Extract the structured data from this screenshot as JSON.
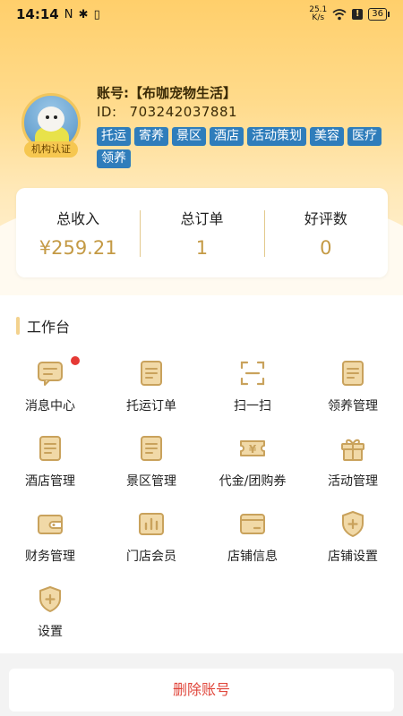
{
  "status_bar": {
    "time": "14:14",
    "left_icons": "N ✱ ▯",
    "speed_top": "25.1",
    "speed_bottom": "K/s",
    "alert": "!",
    "battery": "36"
  },
  "profile": {
    "account_label": "账号:【布咖宠物生活】",
    "id_label": "ID:",
    "id_value": "703242037881",
    "cert_badge": "机构认证",
    "tags": [
      "托运",
      "寄养",
      "景区",
      "酒店",
      "活动策划",
      "美容",
      "医疗",
      "领养"
    ]
  },
  "stats": [
    {
      "label": "总收入",
      "value": "¥259.21"
    },
    {
      "label": "总订单",
      "value": "1"
    },
    {
      "label": "好评数",
      "value": "0"
    }
  ],
  "workbench": {
    "title": "工作台",
    "items": [
      {
        "label": "消息中心",
        "icon": "message-icon",
        "badge": true
      },
      {
        "label": "托运订单",
        "icon": "document-icon"
      },
      {
        "label": "扫一扫",
        "icon": "scan-icon"
      },
      {
        "label": "领养管理",
        "icon": "document-icon"
      },
      {
        "label": "酒店管理",
        "icon": "document-icon"
      },
      {
        "label": "景区管理",
        "icon": "document-icon"
      },
      {
        "label": "代金/团购券",
        "icon": "coupon-icon"
      },
      {
        "label": "活动管理",
        "icon": "gift-icon"
      },
      {
        "label": "财务管理",
        "icon": "wallet-icon"
      },
      {
        "label": "门店会员",
        "icon": "chart-icon"
      },
      {
        "label": "店铺信息",
        "icon": "card-icon"
      },
      {
        "label": "店铺设置",
        "icon": "shield-plus-icon"
      },
      {
        "label": "设置",
        "icon": "shield-plus-icon"
      }
    ]
  },
  "delete_button": "删除账号",
  "colors": {
    "accent": "#c49a45",
    "icon": "#c9a25c",
    "tag": "#2f7dbb",
    "danger": "#e0453a"
  }
}
